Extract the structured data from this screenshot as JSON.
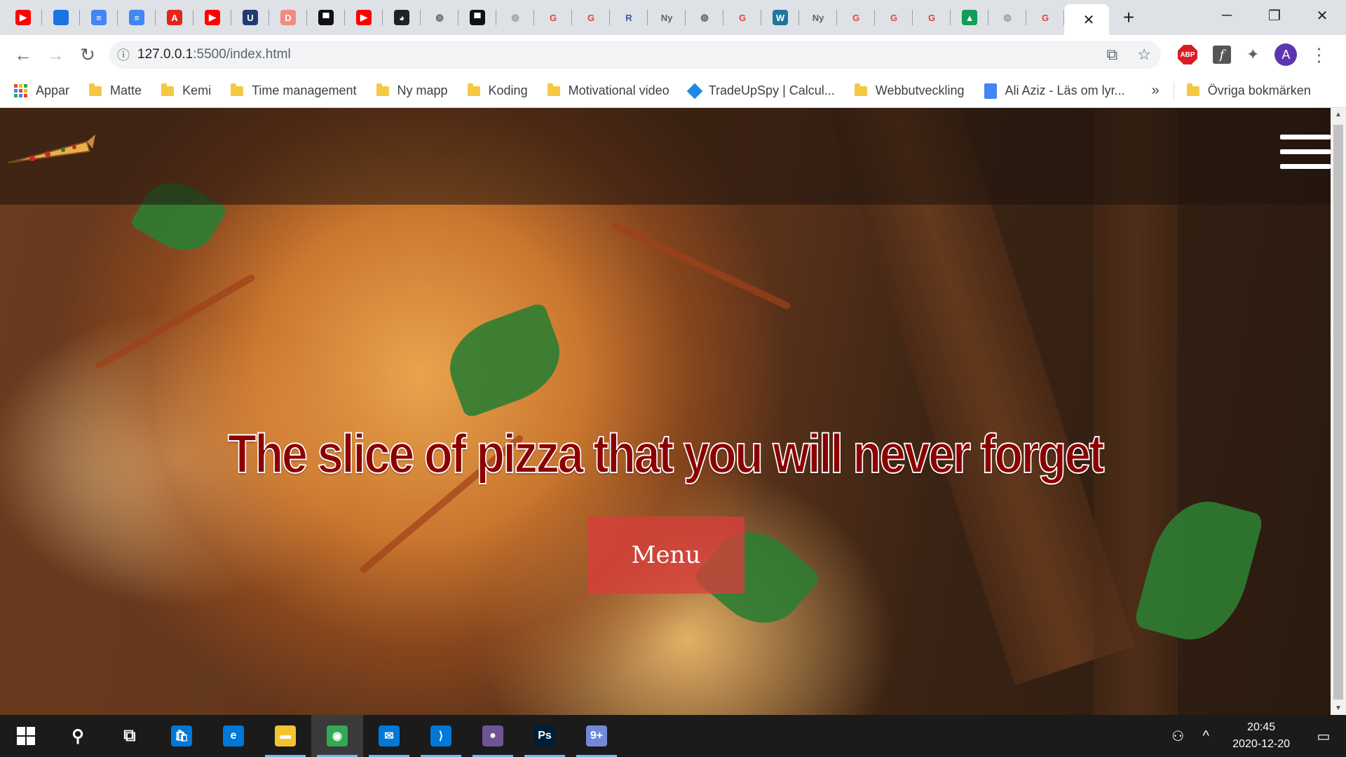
{
  "browser": {
    "tabs": [
      {
        "icon": "youtube-icon",
        "glyph": "▶",
        "color": "#ff0000"
      },
      {
        "icon": "contacts-icon",
        "glyph": "👤",
        "color": "#1a73e8"
      },
      {
        "icon": "docs-icon",
        "glyph": "≡",
        "color": "#4285f4"
      },
      {
        "icon": "docs-icon",
        "glyph": "≡",
        "color": "#4285f4"
      },
      {
        "icon": "adobe-icon",
        "glyph": "A",
        "color": "#e1251b"
      },
      {
        "icon": "youtube-icon",
        "glyph": "▶",
        "color": "#ff0000"
      },
      {
        "icon": "shield-icon",
        "glyph": "U",
        "color": "#1f3b73"
      },
      {
        "icon": "reader-icon",
        "glyph": "D",
        "color": "#f28b82"
      },
      {
        "icon": "box-icon",
        "glyph": "▀",
        "color": "#111111"
      },
      {
        "icon": "youtube-icon",
        "glyph": "▶",
        "color": "#ff0000"
      },
      {
        "icon": "panda-icon",
        "glyph": "◕",
        "color": "#222222"
      },
      {
        "icon": "globe-icon",
        "glyph": "◍",
        "color": "#5f6368"
      },
      {
        "icon": "box-icon",
        "glyph": "▀",
        "color": "#111111"
      },
      {
        "icon": "globe-icon",
        "glyph": "◍",
        "color": "#9aa0a6"
      },
      {
        "icon": "google-icon",
        "glyph": "G",
        "color": "#ea4335"
      },
      {
        "icon": "google-icon",
        "glyph": "G",
        "color": "#ea4335"
      },
      {
        "icon": "r-icon",
        "glyph": "R",
        "color": "#3f51b5"
      },
      {
        "icon": "ny-icon",
        "glyph": "Ny",
        "color": "#5f6368"
      },
      {
        "icon": "globe-icon",
        "glyph": "◍",
        "color": "#5f6368"
      },
      {
        "icon": "google-icon",
        "glyph": "G",
        "color": "#ea4335"
      },
      {
        "icon": "wordpress-icon",
        "glyph": "W",
        "color": "#21759b"
      },
      {
        "icon": "ny-icon",
        "glyph": "Ny",
        "color": "#5f6368"
      },
      {
        "icon": "google-icon",
        "glyph": "G",
        "color": "#ea4335"
      },
      {
        "icon": "google-icon",
        "glyph": "G",
        "color": "#ea4335"
      },
      {
        "icon": "google-icon",
        "glyph": "G",
        "color": "#ea4335"
      },
      {
        "icon": "drive-icon",
        "glyph": "▲",
        "color": "#0f9d58"
      },
      {
        "icon": "globe-icon",
        "glyph": "◍",
        "color": "#9aa0a6"
      },
      {
        "icon": "google-icon",
        "glyph": "G",
        "color": "#ea4335"
      }
    ],
    "address": {
      "host": "127.0.0.1",
      "path": ":5500/index.html"
    },
    "extensions": {
      "abp": "ABP",
      "avatar": "A"
    },
    "bookmarks": [
      {
        "label": "Appar",
        "icon": "apps"
      },
      {
        "label": "Matte",
        "icon": "folder"
      },
      {
        "label": "Kemi",
        "icon": "folder"
      },
      {
        "label": "Time management",
        "icon": "folder"
      },
      {
        "label": "Ny mapp",
        "icon": "folder"
      },
      {
        "label": "Koding",
        "icon": "folder"
      },
      {
        "label": "Motivational video",
        "icon": "folder"
      },
      {
        "label": "TradeUpSpy | Calcul...",
        "icon": "diamond"
      },
      {
        "label": "Webbutveckling",
        "icon": "folder"
      },
      {
        "label": "Ali Aziz - Läs om lyr...",
        "icon": "doc"
      }
    ],
    "bookmarks_more": "»",
    "other_bookmarks": "Övriga bokmärken"
  },
  "page": {
    "hero_title": "The slice of pizza that you will never forget",
    "menu_button": "Menu"
  },
  "taskbar": {
    "apps": [
      {
        "name": "search-icon",
        "glyph": "⚲",
        "color": "transparent"
      },
      {
        "name": "task-view-icon",
        "glyph": "⧉",
        "color": "transparent"
      },
      {
        "name": "store-icon",
        "glyph": "🛍",
        "color": "#0078d7"
      },
      {
        "name": "edge-icon",
        "glyph": "e",
        "color": "#0078d7"
      },
      {
        "name": "file-explorer-icon",
        "glyph": "▬",
        "color": "#f4c430"
      },
      {
        "name": "chrome-icon",
        "glyph": "◉",
        "color": "#34a853"
      },
      {
        "name": "mail-icon",
        "glyph": "✉",
        "color": "#0078d7"
      },
      {
        "name": "vscode-icon",
        "glyph": "⟩",
        "color": "#0078d7"
      },
      {
        "name": "github-icon",
        "glyph": "●",
        "color": "#6e5494"
      },
      {
        "name": "photoshop-icon",
        "glyph": "Ps",
        "color": "#001e36"
      },
      {
        "name": "discord-icon",
        "glyph": "9+",
        "color": "#7289da"
      }
    ],
    "time": "20:45",
    "date": "2020-12-20"
  }
}
